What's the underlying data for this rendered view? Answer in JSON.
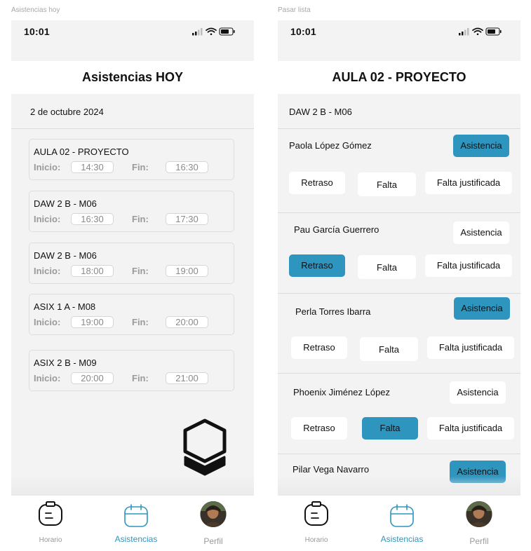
{
  "screen1": {
    "frame_label": "Asistencias hoy",
    "status_time": "10:01",
    "title": "Asistencias HOY",
    "date": "2 de octubre 2024",
    "start_label": "Inicio:",
    "end_label": "Fin:",
    "classes": [
      {
        "name": "AULA 02 - PROYECTO",
        "start": "14:30",
        "end": "16:30"
      },
      {
        "name": "DAW 2 B - M06",
        "start": "16:30",
        "end": "17:30"
      },
      {
        "name": "DAW 2 B - M06",
        "start": "18:00",
        "end": "19:00"
      },
      {
        "name": "ASIX 1 A - M08",
        "start": "19:00",
        "end": "20:00"
      },
      {
        "name": "ASIX 2 B - M09",
        "start": "20:00",
        "end": "21:00"
      }
    ]
  },
  "screen2": {
    "frame_label": "Pasar lista",
    "status_time": "10:01",
    "title": "AULA 02 - PROYECTO",
    "group": "DAW 2 B - M06",
    "buttons": {
      "attendance": "Asistencia",
      "late": "Retraso",
      "absence": "Falta",
      "justified": "Falta justificada"
    },
    "students": [
      {
        "name": "Paola López Gómez",
        "selected": "attendance"
      },
      {
        "name": "Pau García Guerrero",
        "selected": "late"
      },
      {
        "name": "Perla Torres Ibarra",
        "selected": "attendance"
      },
      {
        "name": "Phoenix  Jiménez López",
        "selected": "absence"
      },
      {
        "name": "Pilar Vega Navarro",
        "selected": "attendance"
      }
    ]
  },
  "tabs": [
    {
      "label": "Horario",
      "icon": "schedule-icon"
    },
    {
      "label": "Asistencias",
      "icon": "attendance-icon",
      "active": true
    },
    {
      "label": "Perfil",
      "icon": "profile-avatar"
    }
  ],
  "colors": {
    "accent": "#2e95bf",
    "background": "#f3f3f3",
    "white": "#ffffff"
  }
}
